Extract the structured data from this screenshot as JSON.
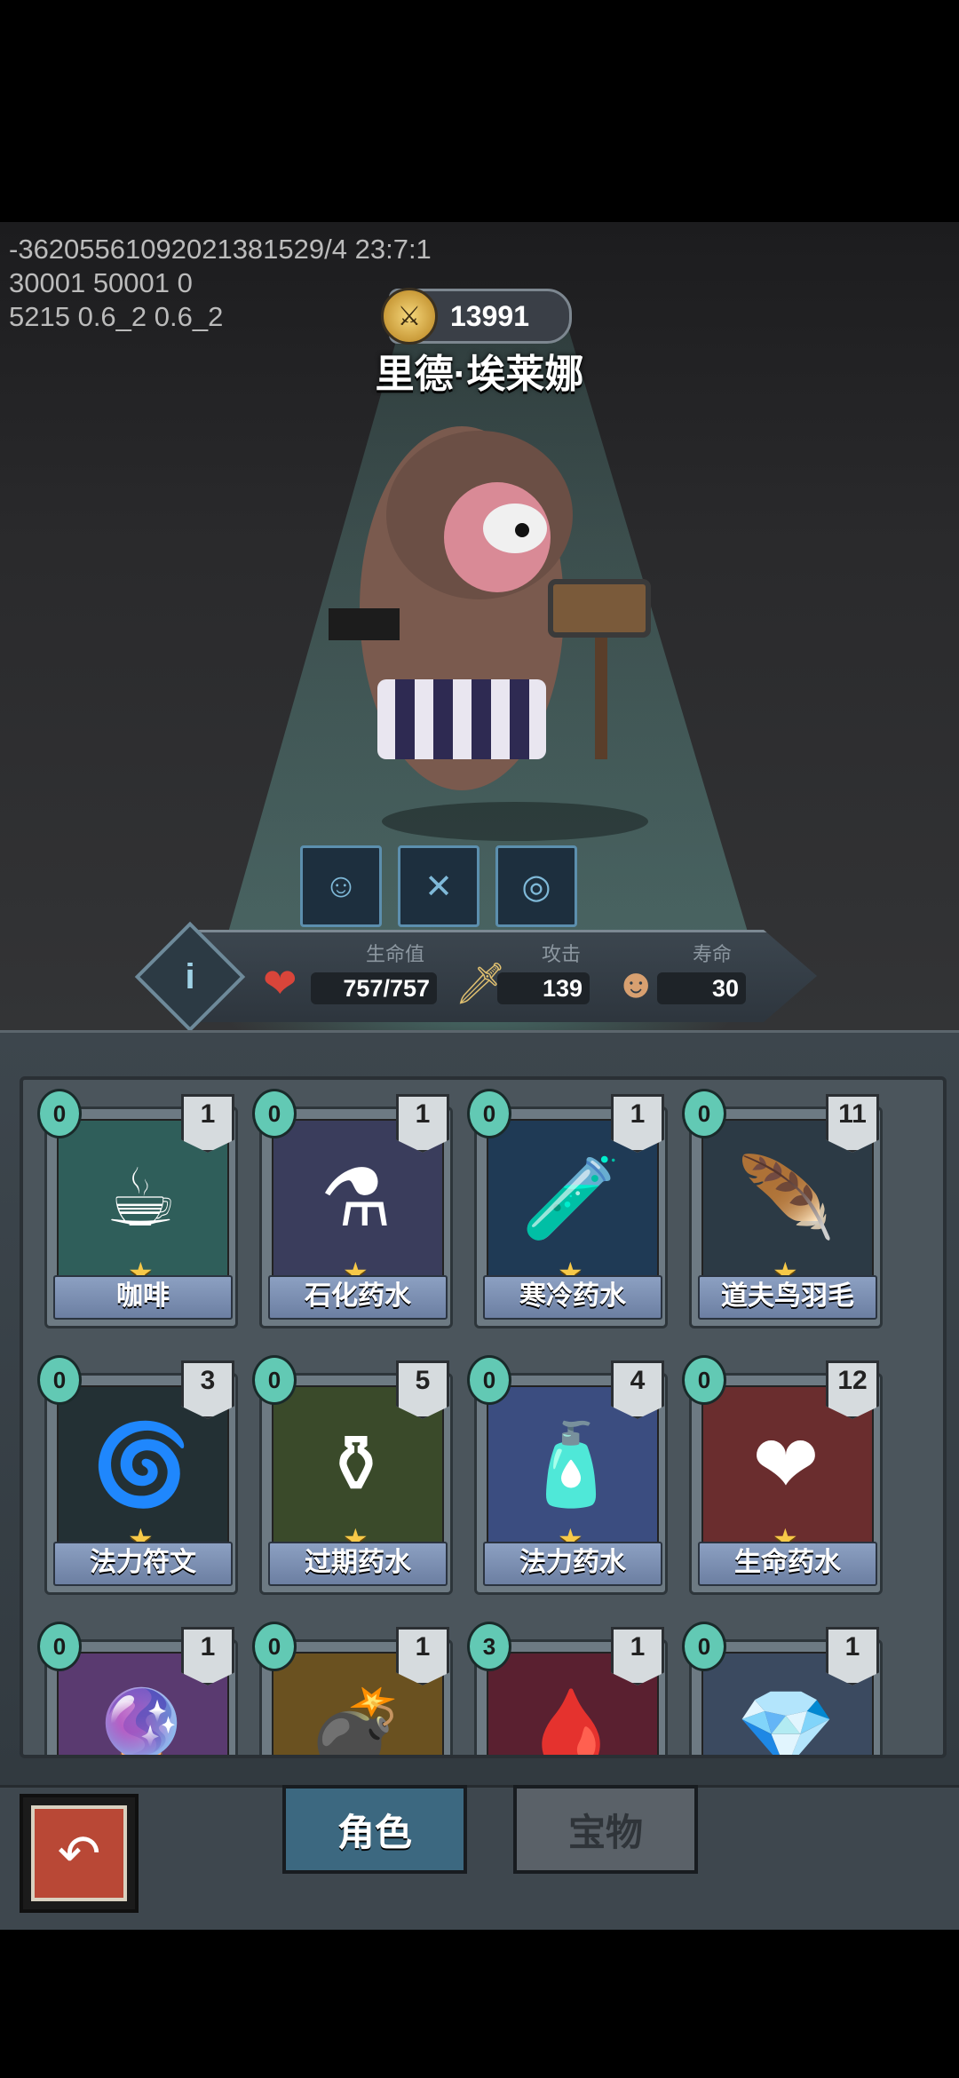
{
  "debug_lines": [
    "-36205561092021381529/4 23:7:1",
    "30001 50001 0",
    "5215 0.6_2 0.6_2"
  ],
  "hero": {
    "power": "13991",
    "name": "里德·埃莱娜"
  },
  "skills": [
    {
      "icon": "shield-face-icon"
    },
    {
      "icon": "crossed-guns-icon"
    },
    {
      "icon": "bomb-icon"
    }
  ],
  "stats": {
    "hp_label": "生命值",
    "hp_value": "757/757",
    "attack_label": "攻击",
    "attack_value": "139",
    "life_label": "寿命",
    "life_value": "30"
  },
  "cards": [
    {
      "name": "咖啡",
      "cost": "0",
      "count": "1",
      "starred": true,
      "color": "#2f5e5a",
      "glyph": "☕"
    },
    {
      "name": "石化药水",
      "cost": "0",
      "count": "1",
      "starred": true,
      "color": "#3a3d5c",
      "glyph": "⚗"
    },
    {
      "name": "寒冷药水",
      "cost": "0",
      "count": "1",
      "starred": true,
      "color": "#1f3a55",
      "glyph": "🧪"
    },
    {
      "name": "道夫鸟羽毛",
      "cost": "0",
      "count": "11",
      "starred": true,
      "color": "#2c3a45",
      "glyph": "🪶"
    },
    {
      "name": "法力符文",
      "cost": "0",
      "count": "3",
      "starred": true,
      "color": "#233034",
      "glyph": "🌀"
    },
    {
      "name": "过期药水",
      "cost": "0",
      "count": "5",
      "starred": true,
      "color": "#3a4a2a",
      "glyph": "⚱"
    },
    {
      "name": "法力药水",
      "cost": "0",
      "count": "4",
      "starred": true,
      "color": "#3b4d80",
      "glyph": "🧴"
    },
    {
      "name": "生命药水",
      "cost": "0",
      "count": "12",
      "starred": true,
      "color": "#6a2d2e",
      "glyph": "❤"
    },
    {
      "name": "",
      "cost": "0",
      "count": "1",
      "starred": false,
      "color": "#5a3a70",
      "glyph": "🔮"
    },
    {
      "name": "",
      "cost": "0",
      "count": "1",
      "starred": false,
      "color": "#6a5120",
      "glyph": "💣"
    },
    {
      "name": "",
      "cost": "3",
      "count": "1",
      "starred": false,
      "color": "#5a2030",
      "glyph": "🩸"
    },
    {
      "name": "",
      "cost": "0",
      "count": "1",
      "starred": false,
      "color": "#3b4a60",
      "glyph": "💎"
    }
  ],
  "tabs": {
    "character": "角色",
    "treasure": "宝物"
  }
}
